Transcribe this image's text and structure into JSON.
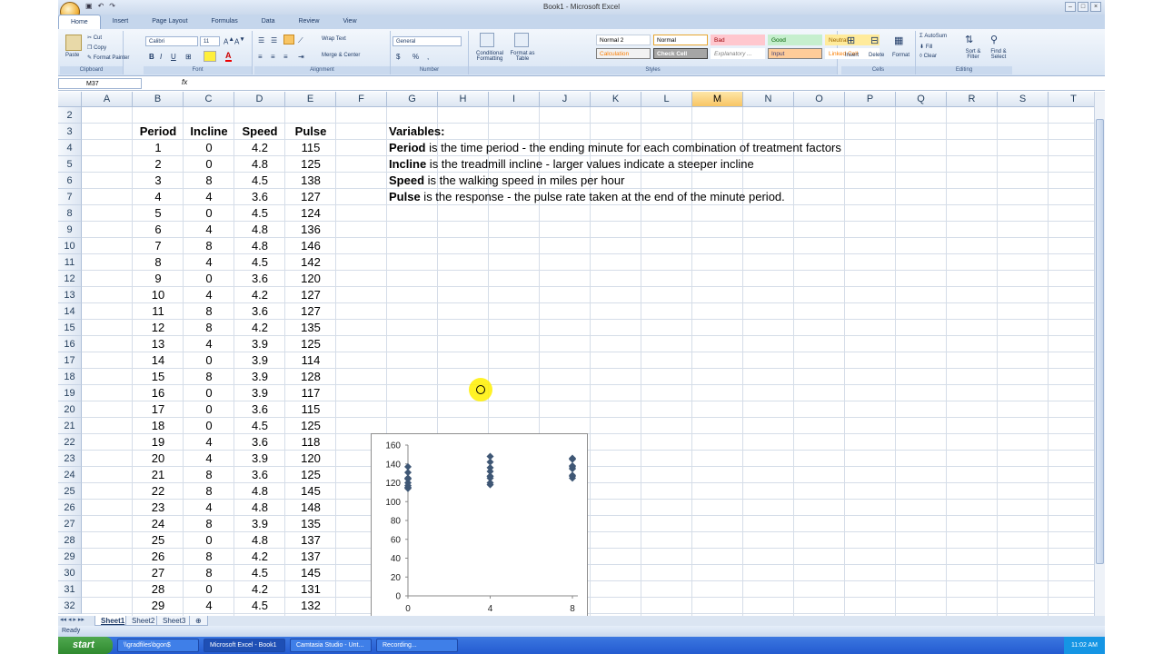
{
  "window": {
    "title": "Book1 - Microsoft Excel"
  },
  "tabs": [
    "Home",
    "Insert",
    "Page Layout",
    "Formulas",
    "Data",
    "Review",
    "View"
  ],
  "ribbon": {
    "clipboard": {
      "paste": "Paste",
      "cut": "Cut",
      "copy": "Copy",
      "format_painter": "Format Painter",
      "label": "Clipboard"
    },
    "font": {
      "name": "Calibri",
      "size": "11",
      "bold": "B",
      "italic": "I",
      "underline": "U",
      "label": "Font"
    },
    "alignment": {
      "wrap": "Wrap Text",
      "merge": "Merge & Center",
      "label": "Alignment"
    },
    "number": {
      "format": "General",
      "dollar": "$",
      "percent": "%",
      "comma": ",",
      "label": "Number"
    },
    "styles": {
      "conditional": "Conditional Formatting",
      "format_table": "Format as Table",
      "cells": [
        "Normal 2",
        "Normal",
        "Bad",
        "Good",
        "Neutral",
        "Calculation",
        "Check Cell",
        "Explanatory ...",
        "Input",
        "Linked Cell"
      ],
      "label": "Styles"
    },
    "cells": {
      "insert": "Insert",
      "delete": "Delete",
      "format": "Format",
      "label": "Cells"
    },
    "editing": {
      "autosum": "AutoSum",
      "fill": "Fill",
      "clear": "Clear",
      "sort": "Sort & Filter",
      "find": "Find & Select",
      "label": "Editing"
    }
  },
  "formula_bar": {
    "name_box": "M37",
    "fx": "fx",
    "content": ""
  },
  "columns": [
    "A",
    "B",
    "C",
    "D",
    "E",
    "F",
    "G",
    "H",
    "I",
    "J",
    "K",
    "L",
    "M",
    "N",
    "O",
    "P",
    "Q",
    "R",
    "S",
    "T"
  ],
  "selected_column": "M",
  "rows": [
    "2",
    "3",
    "4",
    "5",
    "6",
    "7",
    "8",
    "9",
    "10",
    "11",
    "12",
    "13",
    "14",
    "15",
    "16",
    "17",
    "18",
    "19",
    "20",
    "21",
    "22",
    "23",
    "24",
    "25",
    "26",
    "27",
    "28",
    "29",
    "30",
    "31",
    "32"
  ],
  "table": {
    "headers": [
      "Period",
      "Incline",
      "Speed",
      "Pulse"
    ],
    "rows": [
      [
        "1",
        "0",
        "4.2",
        "115"
      ],
      [
        "2",
        "0",
        "4.8",
        "125"
      ],
      [
        "3",
        "8",
        "4.5",
        "138"
      ],
      [
        "4",
        "4",
        "3.6",
        "127"
      ],
      [
        "5",
        "0",
        "4.5",
        "124"
      ],
      [
        "6",
        "4",
        "4.8",
        "136"
      ],
      [
        "7",
        "8",
        "4.8",
        "146"
      ],
      [
        "8",
        "4",
        "4.5",
        "142"
      ],
      [
        "9",
        "0",
        "3.6",
        "120"
      ],
      [
        "10",
        "4",
        "4.2",
        "127"
      ],
      [
        "11",
        "8",
        "3.6",
        "127"
      ],
      [
        "12",
        "8",
        "4.2",
        "135"
      ],
      [
        "13",
        "4",
        "3.9",
        "125"
      ],
      [
        "14",
        "0",
        "3.9",
        "114"
      ],
      [
        "15",
        "8",
        "3.9",
        "128"
      ],
      [
        "16",
        "0",
        "3.9",
        "117"
      ],
      [
        "17",
        "0",
        "3.6",
        "115"
      ],
      [
        "18",
        "0",
        "4.5",
        "125"
      ],
      [
        "19",
        "4",
        "3.6",
        "118"
      ],
      [
        "20",
        "4",
        "3.9",
        "120"
      ],
      [
        "21",
        "8",
        "3.6",
        "125"
      ],
      [
        "22",
        "8",
        "4.8",
        "145"
      ],
      [
        "23",
        "4",
        "4.8",
        "148"
      ],
      [
        "24",
        "8",
        "3.9",
        "135"
      ],
      [
        "25",
        "0",
        "4.8",
        "137"
      ],
      [
        "26",
        "8",
        "4.2",
        "137"
      ],
      [
        "27",
        "8",
        "4.5",
        "145"
      ],
      [
        "28",
        "0",
        "4.2",
        "131"
      ],
      [
        "29",
        "4",
        "4.5",
        "132"
      ]
    ]
  },
  "notes": {
    "title": "Variables:",
    "lines": [
      {
        "term": "Period",
        "text": " is the time period - the ending minute for each combination of treatment factors"
      },
      {
        "term": "Incline",
        "text": " is the treadmill incline - larger values indicate a steeper incline"
      },
      {
        "term": "Speed",
        "text": " is the walking speed in miles per hour"
      },
      {
        "term": "Pulse",
        "text": " is the response - the pulse rate taken at the end of the minute period."
      }
    ]
  },
  "chart_data": {
    "type": "scatter",
    "title": "",
    "xlabel": "",
    "ylabel": "",
    "xticks": [
      "0",
      "4",
      "8"
    ],
    "yticks": [
      "0",
      "20",
      "40",
      "60",
      "80",
      "100",
      "120",
      "140",
      "160"
    ],
    "ylim": [
      0,
      160
    ],
    "marker_color": "#3f5775",
    "points": [
      [
        0,
        115
      ],
      [
        0,
        125
      ],
      [
        0,
        124
      ],
      [
        0,
        120
      ],
      [
        0,
        114
      ],
      [
        0,
        117
      ],
      [
        0,
        115
      ],
      [
        0,
        125
      ],
      [
        0,
        137
      ],
      [
        0,
        131
      ],
      [
        4,
        127
      ],
      [
        4,
        136
      ],
      [
        4,
        142
      ],
      [
        4,
        127
      ],
      [
        4,
        125
      ],
      [
        4,
        118
      ],
      [
        4,
        120
      ],
      [
        4,
        148
      ],
      [
        4,
        132
      ],
      [
        8,
        138
      ],
      [
        8,
        146
      ],
      [
        8,
        127
      ],
      [
        8,
        135
      ],
      [
        8,
        128
      ],
      [
        8,
        125
      ],
      [
        8,
        145
      ],
      [
        8,
        135
      ],
      [
        8,
        137
      ],
      [
        8,
        145
      ]
    ]
  },
  "sheet_tabs": [
    "Sheet1",
    "Sheet2",
    "Sheet3"
  ],
  "active_sheet": "Sheet1",
  "status": {
    "mode": "Ready"
  },
  "taskbar": {
    "start": "start",
    "items": [
      "\\\\gradfiles\\bgon$",
      "Microsoft Excel - Book1",
      "Camtasia Studio - Unt...",
      "Recording..."
    ],
    "clock": "11:02 AM"
  }
}
